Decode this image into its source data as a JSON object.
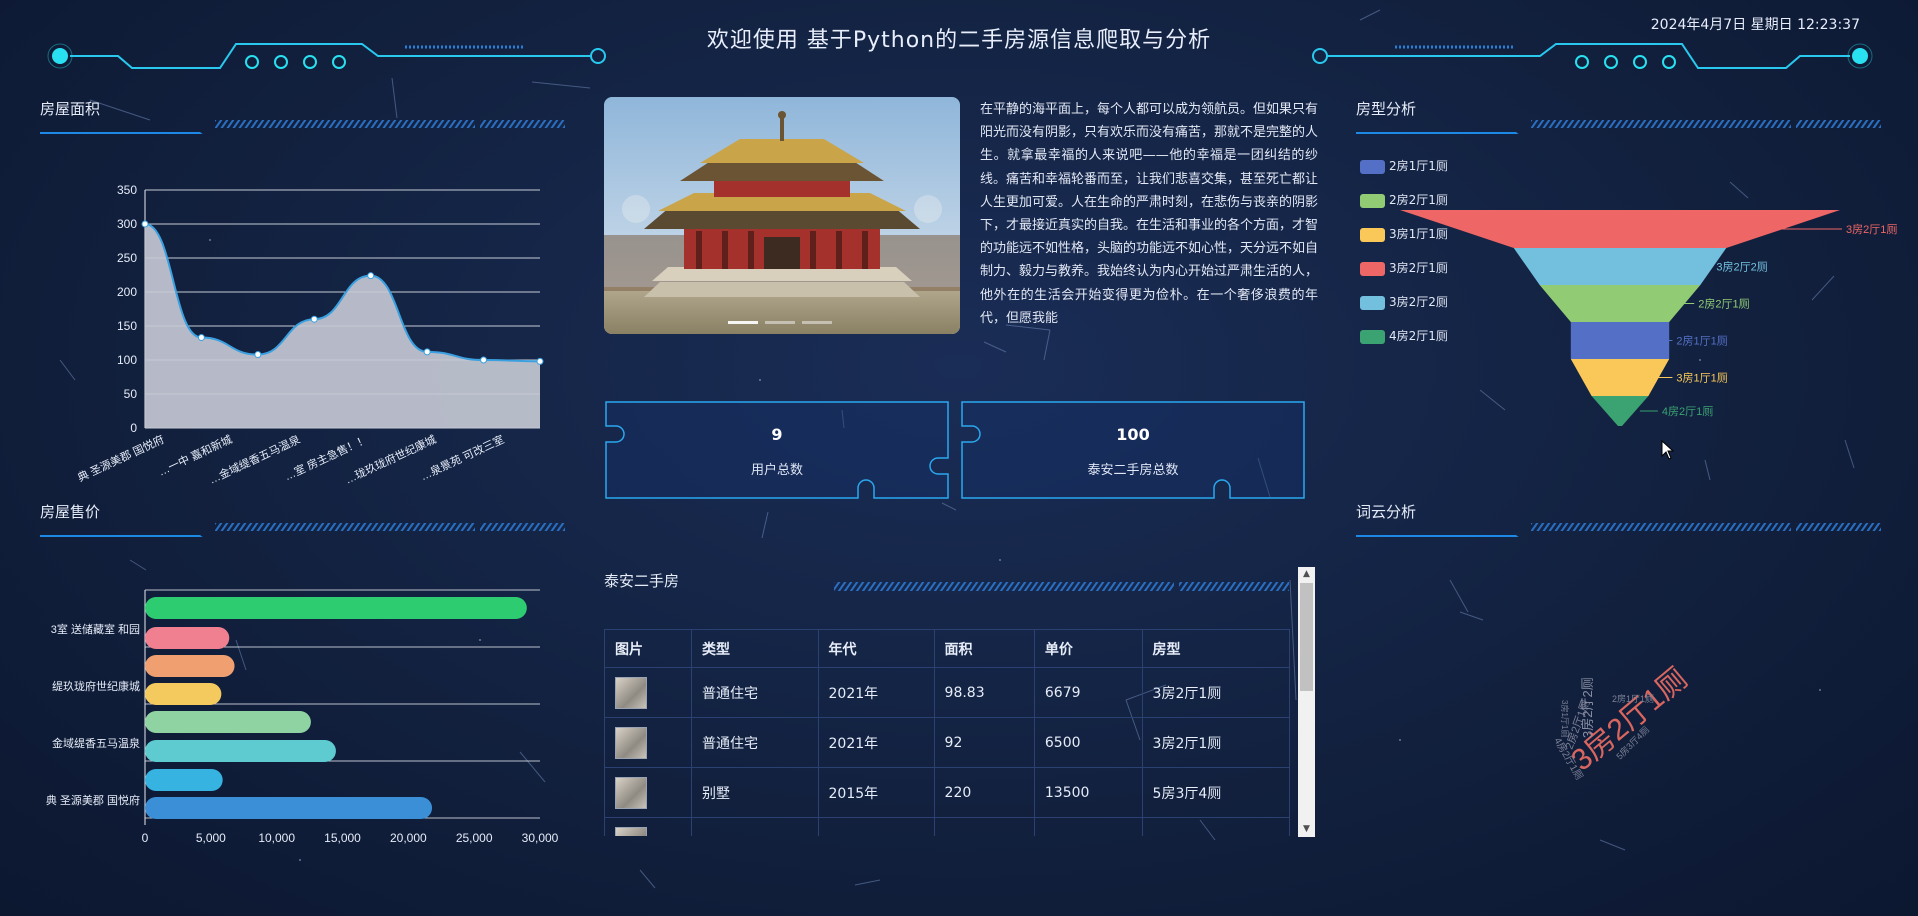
{
  "header": {
    "title": "欢迎使用 基于Python的二手房源信息爬取与分析",
    "datetime": "2024年4月7日 星期日 12:23:37"
  },
  "sections": {
    "area": "房屋面积",
    "price": "房屋售价",
    "house_type": "房型分析",
    "wordcloud": "词云分析",
    "listing": "泰安二手房"
  },
  "intro_text": "在平静的海平面上，每个人都可以成为领航员。但如果只有阳光而没有阴影，只有欢乐而没有痛苦，那就不是完整的人生。就拿最幸福的人来说吧——他的幸福是一团纠结的纱线。痛苦和幸福轮番而至，让我们悲喜交集，甚至死亡都让人生更加可爱。人在生命的严肃时刻，在悲伤与丧亲的阴影下，才最接近真实的自我。在生活和事业的各个方面，才智的功能远不如性格，头脑的功能远不如心性，天分远不如自制力、毅力与教养。我始终认为内心开始过严肃生活的人，他外在的生活会开始变得更为俭朴。在一个奢侈浪费的年代，但愿我能",
  "stats": [
    {
      "value": "9",
      "label": "用户总数"
    },
    {
      "value": "100",
      "label": "泰安二手房总数"
    }
  ],
  "table": {
    "headers": [
      "图片",
      "类型",
      "年代",
      "面积",
      "单价",
      "房型"
    ],
    "rows": [
      [
        "",
        "普通住宅",
        "2021年",
        "98.83",
        "6679",
        "3房2厅1厕"
      ],
      [
        "",
        "普通住宅",
        "2021年",
        "92",
        "6500",
        "3房2厅1厕"
      ],
      [
        "",
        "别墅",
        "2015年",
        "220",
        "13500",
        "5房3厅4厕"
      ]
    ]
  },
  "area_chart": {
    "chart_data": {
      "type": "area",
      "categories": [
        "典 圣源美郡 国悦府",
        "",
        "一中 嘉和新城",
        "",
        "金域缇香五马温泉",
        "",
        "房主急售！！",
        "",
        "玖珑府世纪康城",
        "",
        "泉景苑 可改三室"
      ],
      "x_tick_labels": [
        "典 圣源美郡 国悦府",
        "…一中 嘉和新城",
        "…金域缇香五马温泉",
        "…室 房主急售！！",
        "…珑玖珑府世纪康城",
        "…泉景苑 可改三室"
      ],
      "values": [
        300,
        133,
        108,
        160,
        224,
        112,
        100,
        98
      ],
      "yticks": [
        0,
        50,
        100,
        150,
        200,
        250,
        300,
        350
      ],
      "ylim": [
        0,
        350
      ],
      "grid": true
    }
  },
  "price_chart": {
    "chart_data": {
      "type": "bar",
      "orientation": "horizontal",
      "category_labels": [
        "3室 送储藏室 和园",
        "缇玖珑府世纪康城",
        "金域缇香五马温泉",
        "典 圣源美郡 国悦府"
      ],
      "values": [
        29000,
        6400,
        6800,
        5800,
        12600,
        14500,
        5900,
        21800
      ],
      "colors": [
        "#2ecc71",
        "#f07f8f",
        "#f0a070",
        "#f4ca5e",
        "#8fd3a3",
        "#5ecbd0",
        "#36b3e0",
        "#3a8fd6"
      ],
      "xticks": [
        "0",
        "5,000",
        "10,000",
        "15,000",
        "20,000",
        "25,000",
        "30,000"
      ],
      "xlim": [
        0,
        30000
      ],
      "grid": true
    }
  },
  "funnel_chart": {
    "chart_data": {
      "type": "funnel",
      "legend": [
        "2房1厅1厕",
        "2房2厅1厕",
        "3房1厅1厕",
        "3房2厅1厕",
        "3房2厅2厕",
        "4房2厅1厕"
      ],
      "legend_colors": [
        "#5470c6",
        "#91cc75",
        "#fac858",
        "#ee6666",
        "#73c0de",
        "#3ba272"
      ],
      "slices": [
        {
          "name": "3房2厅1厕",
          "value": 60,
          "color": "#ee6666"
        },
        {
          "name": "3房2厅2厕",
          "value": 14,
          "color": "#73c0de"
        },
        {
          "name": "2房2厅1厕",
          "value": 8,
          "color": "#91cc75"
        },
        {
          "name": "2房1厅1厕",
          "value": 3,
          "color": "#5470c6"
        },
        {
          "name": "3房1厅1厕",
          "value": 3,
          "color": "#fac858"
        },
        {
          "name": "4房2厅1厕",
          "value": 1,
          "color": "#3ba272"
        }
      ]
    }
  },
  "wordcloud": {
    "words": [
      {
        "text": "3房2厅1厕",
        "color": "#d9665f"
      },
      {
        "text": "3房2厅2厕",
        "color": "#8a8fa3"
      },
      {
        "text": "2房2厅1厕",
        "color": "#7c8196"
      },
      {
        "text": "4房2厅1厕",
        "color": "#7c8196"
      },
      {
        "text": "2房1厅1厕",
        "color": "#7c8196"
      },
      {
        "text": "5房3厅4厕",
        "color": "#7c8196"
      },
      {
        "text": "3房1厅1厕",
        "color": "#7c8196"
      }
    ]
  }
}
